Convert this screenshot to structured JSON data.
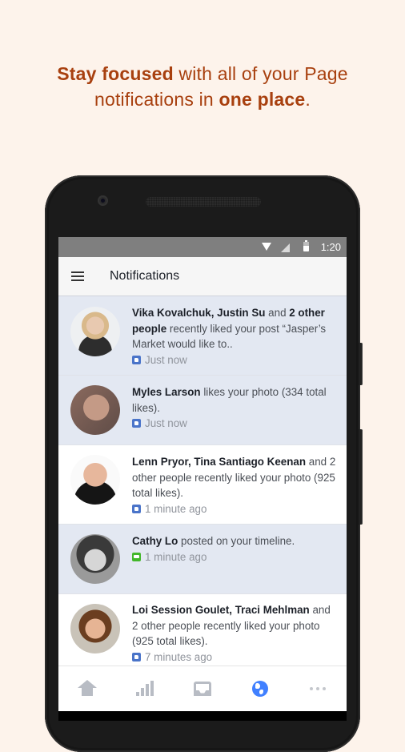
{
  "headline": {
    "bold1": "Stay focused",
    "text1": " with all of your Page",
    "text2": "notifications in ",
    "bold2": "one place",
    "text3": "."
  },
  "status_bar": {
    "time": "1:20",
    "icons": [
      "wifi-icon",
      "signal-icon",
      "battery-icon"
    ]
  },
  "app_bar": {
    "menu_icon": "hamburger-icon",
    "title": "Notifications"
  },
  "notifications": [
    {
      "unread": true,
      "bold_a": "Vika Kovalchuk, Justin Su",
      "mid": " and ",
      "bold_b": "2 other people",
      "rest": " recently liked your post “Jasper’s Market would like to..",
      "icon": "like-icon",
      "time": "Just now"
    },
    {
      "unread": true,
      "bold_a": "Myles Larson",
      "mid": " likes your photo (334 total likes).",
      "bold_b": "",
      "rest": "",
      "icon": "like-icon",
      "time": "Just now"
    },
    {
      "unread": false,
      "bold_a": "Lenn Pryor, Tina Santiago Keenan",
      "mid": " and 2 other people recently liked your photo (925 total likes).",
      "bold_b": "",
      "rest": "",
      "icon": "like-icon",
      "time": "1 minute ago"
    },
    {
      "unread": true,
      "bold_a": "Cathy Lo",
      "mid": " posted on your timeline.",
      "bold_b": "",
      "rest": "",
      "icon": "comment-icon",
      "time": "1 minute ago"
    },
    {
      "unread": false,
      "bold_a": "Loi Session Goulet, Traci Mehlman",
      "mid": " and 2 other people recently liked your photo (925 total likes).",
      "bold_b": "",
      "rest": "",
      "icon": "like-icon",
      "time": "7 minutes ago"
    }
  ],
  "tab_bar": {
    "tabs": [
      {
        "name": "home",
        "icon": "home-icon",
        "active": false
      },
      {
        "name": "insights",
        "icon": "bar-chart-icon",
        "active": false
      },
      {
        "name": "inbox",
        "icon": "inbox-icon",
        "active": false
      },
      {
        "name": "notifications",
        "icon": "globe-icon",
        "active": true
      },
      {
        "name": "more",
        "icon": "more-icon",
        "active": false
      }
    ],
    "active_color": "#4080ff",
    "inactive_color": "#b8bcc4"
  },
  "colors": {
    "background": "#fdf3eb",
    "headline": "#a8400f",
    "unread_row": "#e3e8f2"
  }
}
